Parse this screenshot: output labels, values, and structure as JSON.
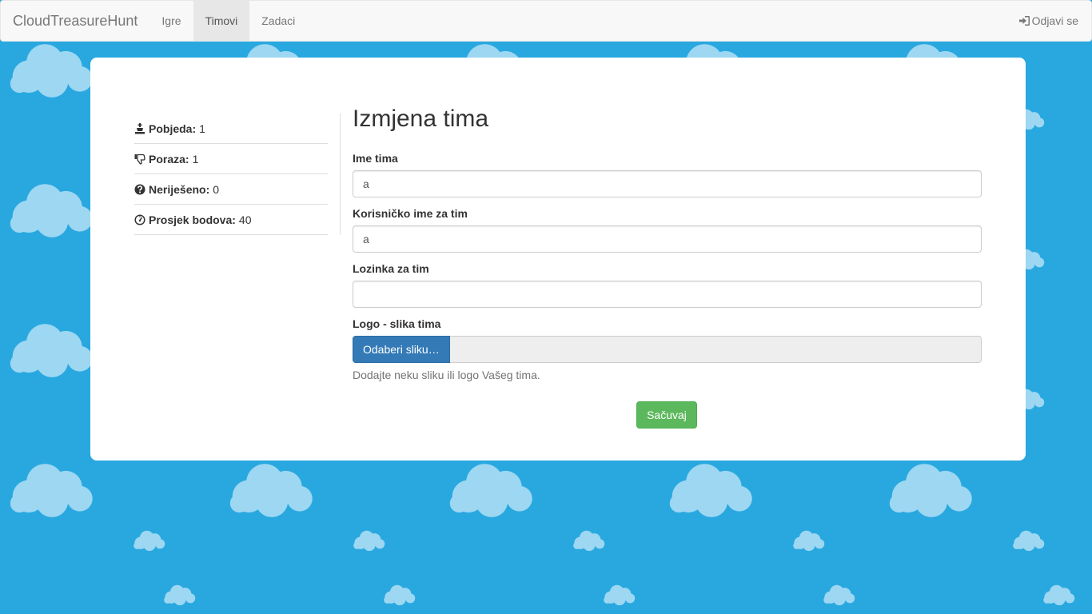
{
  "navbar": {
    "brand": "CloudTreasureHunt",
    "items": [
      {
        "label": "Igre",
        "active": false
      },
      {
        "label": "Timovi",
        "active": true
      },
      {
        "label": "Zadaci",
        "active": false
      }
    ],
    "logout": {
      "label": "Odjavi se",
      "icon": "log-in-icon"
    }
  },
  "stats": [
    {
      "label": "Pobjeda:",
      "value": "1",
      "icon": "king-icon"
    },
    {
      "label": "Poraza:",
      "value": "1",
      "icon": "thumbs-down-icon"
    },
    {
      "label": "Neriješeno:",
      "value": "0",
      "icon": "question-sign-icon"
    },
    {
      "label": "Prosjek bodova:",
      "value": "40",
      "icon": "dashboard-icon"
    }
  ],
  "form": {
    "title": "Izmjena tima",
    "team_name": {
      "label": "Ime tima",
      "value": "a"
    },
    "username": {
      "label": "Korisničko ime za tim",
      "value": "a"
    },
    "password": {
      "label": "Lozinka za tim",
      "value": ""
    },
    "logo": {
      "label": "Logo - slika tima",
      "button": "Odaberi sliku…",
      "help": "Dodajte neku sliku ili logo Vašeg tima."
    },
    "save": "Sačuvaj"
  },
  "colors": {
    "background": "#29a8e0",
    "cloud": "#9dd7f2",
    "primary": "#337ab7",
    "success": "#5cb85c"
  }
}
